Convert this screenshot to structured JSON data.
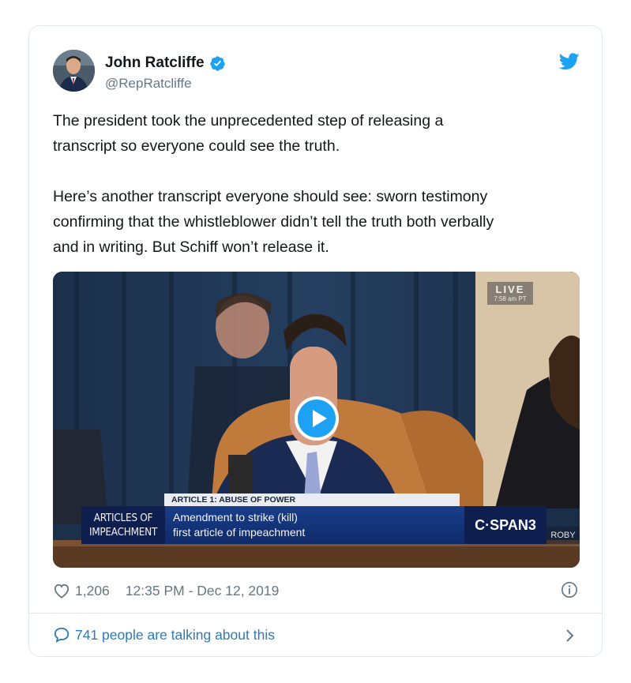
{
  "tweet": {
    "author_name": "John Ratcliffe",
    "handle": "@RepRatcliffe",
    "text": "The president took the unprecedented step of releasing a\ntranscript so everyone could see the truth.\n\nHere’s another transcript everyone should see: sworn testimony\nconfirming that the whistleblower didn’t tell the truth both verbally\nand in writing. But Schiff won’t release it.",
    "likes": "1,206",
    "timestamp": "12:35 PM - Dec 12, 2019",
    "talking": "741 people are talking about this"
  },
  "video": {
    "live_label": "LIVE",
    "live_time": "7:58 am PT",
    "chyron_header": "ARTICLE 1: ABUSE OF POWER",
    "chyron_left_line1": "ARTICLES OF",
    "chyron_left_line2": "IMPEACHMENT",
    "chyron_line1": "Amendment to strike (kill)",
    "chyron_line2": "first article of impeachment",
    "network": "C·SPAN3",
    "name_tag": "ROBY"
  },
  "icons": {
    "verified": "verified-badge-icon",
    "twitter": "twitter-bird-icon",
    "play": "play-icon",
    "like": "heart-icon",
    "info": "info-icon",
    "reply": "speech-bubble-icon",
    "next": "chevron-right-icon"
  },
  "colors": {
    "brand_blue": "#1da1f2",
    "link_blue": "#2b7bb9",
    "text_primary": "#14171a",
    "text_secondary": "#657786",
    "border": "#e1e8ed"
  }
}
